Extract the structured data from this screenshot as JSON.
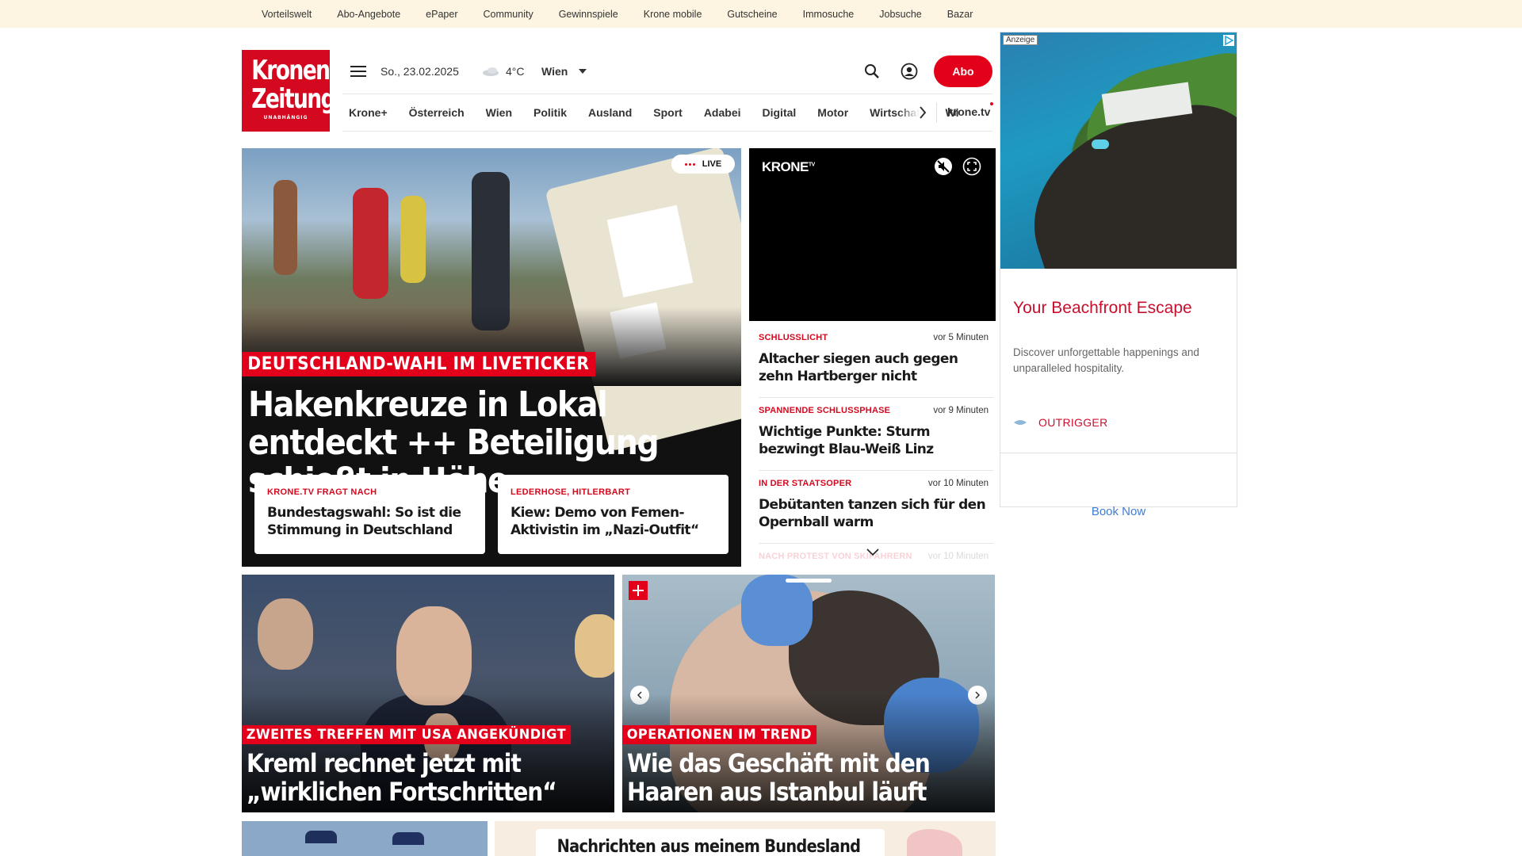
{
  "topbar": {
    "links": [
      "Vorteilswelt",
      "Abo-Angebote",
      "ePaper",
      "Community",
      "Gewinnspiele",
      "Krone mobile",
      "Gutscheine",
      "Immosuche",
      "Jobsuche",
      "Bazar"
    ]
  },
  "logo": {
    "line1": "Kronen",
    "line2": "Zeitung",
    "tagline": "UNABHÄNGIG"
  },
  "header": {
    "date": "So., 23.02.2025",
    "temperature": "4°C",
    "city": "Wien",
    "abo_label": "Abo"
  },
  "nav": {
    "items": [
      "Krone+",
      "Österreich",
      "Wien",
      "Politik",
      "Ausland",
      "Sport",
      "Adabei",
      "Digital",
      "Motor",
      "Wirtschaft",
      "Wi"
    ],
    "krone_tv": "krone.tv"
  },
  "hero": {
    "live_label": "LIVE",
    "kicker": "DEUTSCHLAND-WAHL IM LIVETICKER",
    "headline": "Hakenkreuze in Lokal entdeckt ++ Beteiligung schießt in Höhe",
    "subcards": [
      {
        "kicker": "KRONE.TV FRAGT NACH",
        "title": "Bundestagswahl: So ist die Stimmung in Deutschland"
      },
      {
        "kicker": "LEDERHOSE, HITLERBART",
        "title": "Kiew: Demo von Femen-Aktivistin im „Nazi-Outfit“"
      }
    ]
  },
  "video": {
    "logo": "KRONE",
    "logo_sup": "TV"
  },
  "ticker": [
    {
      "kicker": "SCHLUSSLICHT",
      "time": "vor 5 Minuten",
      "title": "Altacher siegen auch gegen zehn Hartberger nicht"
    },
    {
      "kicker": "SPANNENDE SCHLUSSPHASE",
      "time": "vor 9 Minuten",
      "title": "Wichtige Punkte: Sturm bezwingt Blau-Weiß Linz"
    },
    {
      "kicker": "IN DER STAATSOPER",
      "time": "vor 10 Minuten",
      "title": "Debütanten tanzen sich für den Opernball warm"
    },
    {
      "kicker": "NACH PROTEST VON SKIFAHRERN",
      "time": "vor 10 Minuten",
      "title": ""
    }
  ],
  "ad": {
    "label": "Anzeige",
    "title": "Your Beachfront Escape",
    "description": "Discover unforgettable happenings and unparalleled hospitality.",
    "brand": "OUTRIGGER",
    "cta": "Book Now"
  },
  "cards": [
    {
      "kicker": "ZWEITES TREFFEN MIT USA ANGEKÜNDIGT",
      "headline": "Kreml rechnet jetzt mit „wirklichen Fortschritten“"
    },
    {
      "kicker": "OPERATIONEN IM TREND",
      "headline": "Wie das Geschäft mit den Haaren aus Istanbul läuft"
    }
  ],
  "bundesland": {
    "title": "Nachrichten aus meinem Bundesland"
  },
  "colors": {
    "brand_red": "#e2001a",
    "topbar_bg": "#fdf5e1",
    "ad_title": "#c8102e",
    "ad_cta": "#3f7cd4"
  }
}
